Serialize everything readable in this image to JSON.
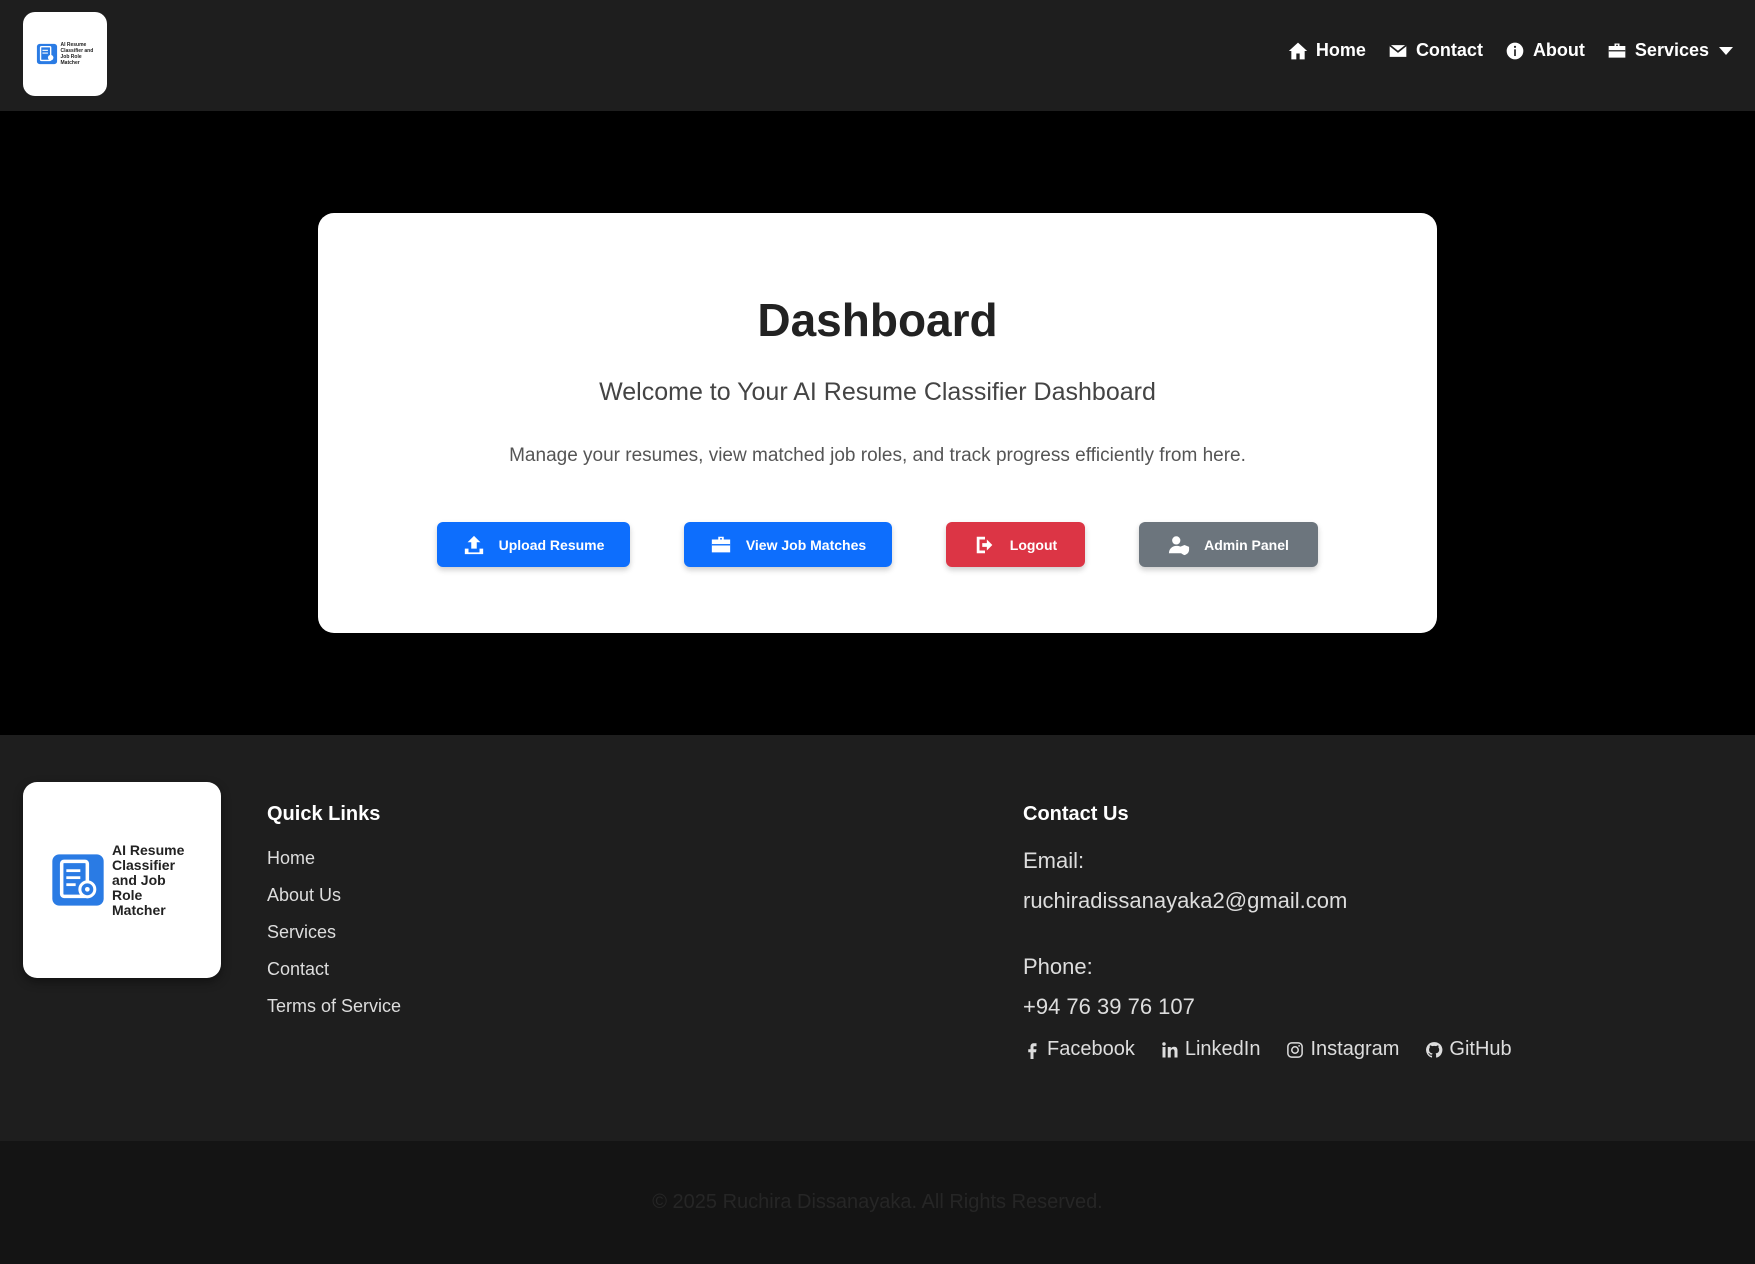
{
  "nav": {
    "logo_text": "AI Resume Classifier and Job Role Matcher",
    "links": [
      {
        "label": "Home",
        "icon": "home-icon"
      },
      {
        "label": "Contact",
        "icon": "envelope-icon"
      },
      {
        "label": "About",
        "icon": "info-icon"
      },
      {
        "label": "Services",
        "icon": "briefcase-icon"
      }
    ]
  },
  "main": {
    "title": "Dashboard",
    "subtitle": "Welcome to Your AI Resume Classifier Dashboard",
    "description": "Manage your resumes, view matched job roles, and track progress efficiently from here.",
    "buttons": {
      "upload": "Upload Resume",
      "jobs": "View Job Matches",
      "logout": "Logout",
      "admin": "Admin Panel"
    }
  },
  "footer": {
    "logo_text": "AI Resume Classifier and Job Role Matcher",
    "quick_links_title": "Quick Links",
    "quick_links": [
      "Home",
      "About Us",
      "Services",
      "Contact",
      "Terms of Service"
    ],
    "contact_title": "Contact Us",
    "email_label": "Email:",
    "email": "ruchiradissanayaka2@gmail.com",
    "phone_label": "Phone:",
    "phone": "+94 76 39 76 107",
    "socials": {
      "facebook": "Facebook",
      "linkedin": "LinkedIn",
      "instagram": "Instagram",
      "github": "GitHub"
    },
    "copyright": "© 2025 Ruchira Dissanayaka. All Rights Reserved."
  },
  "colors": {
    "primary": "#0d6efd",
    "danger": "#dc3545",
    "secondary": "#6c757d",
    "nav_bg": "#1e1e1e"
  }
}
